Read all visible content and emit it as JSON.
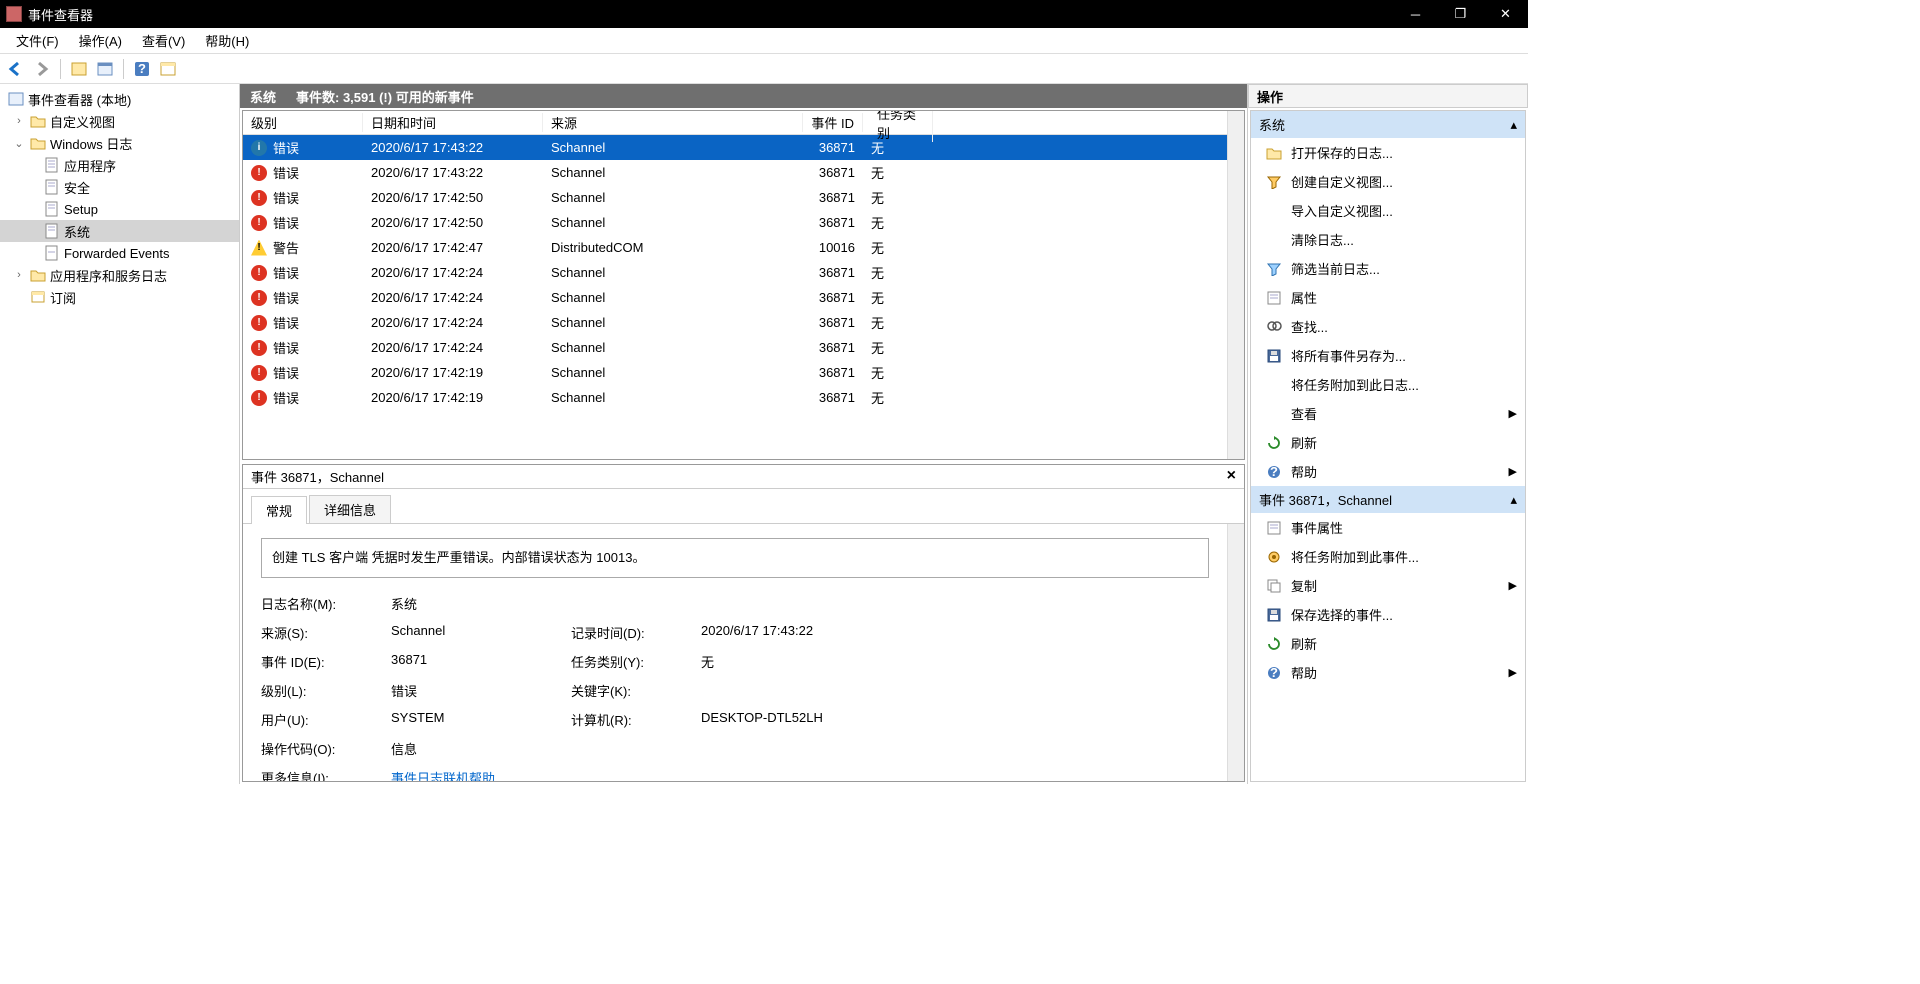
{
  "titlebar": {
    "title": "事件查看器"
  },
  "menubar": {
    "file": "文件(F)",
    "action": "操作(A)",
    "view": "查看(V)",
    "help": "帮助(H)"
  },
  "tree": {
    "root": "事件查看器 (本地)",
    "customViews": "自定义视图",
    "winLogs": "Windows 日志",
    "app": "应用程序",
    "security": "安全",
    "setup": "Setup",
    "system": "系统",
    "forwarded": "Forwarded Events",
    "appServices": "应用程序和服务日志",
    "subscriptions": "订阅"
  },
  "centerHeader": {
    "name": "系统",
    "count": "事件数: 3,591 (!) 可用的新事件"
  },
  "columns": {
    "level": "级别",
    "date": "日期和时间",
    "source": "来源",
    "id": "事件 ID",
    "task": "任务类别"
  },
  "events": [
    {
      "iconType": "info",
      "level": "错误",
      "date": "2020/6/17 17:43:22",
      "source": "Schannel",
      "id": "36871",
      "task": "无",
      "selected": true
    },
    {
      "iconType": "err",
      "level": "错误",
      "date": "2020/6/17 17:43:22",
      "source": "Schannel",
      "id": "36871",
      "task": "无"
    },
    {
      "iconType": "err",
      "level": "错误",
      "date": "2020/6/17 17:42:50",
      "source": "Schannel",
      "id": "36871",
      "task": "无"
    },
    {
      "iconType": "err",
      "level": "错误",
      "date": "2020/6/17 17:42:50",
      "source": "Schannel",
      "id": "36871",
      "task": "无"
    },
    {
      "iconType": "warn",
      "level": "警告",
      "date": "2020/6/17 17:42:47",
      "source": "DistributedCOM",
      "id": "10016",
      "task": "无"
    },
    {
      "iconType": "err",
      "level": "错误",
      "date": "2020/6/17 17:42:24",
      "source": "Schannel",
      "id": "36871",
      "task": "无"
    },
    {
      "iconType": "err",
      "level": "错误",
      "date": "2020/6/17 17:42:24",
      "source": "Schannel",
      "id": "36871",
      "task": "无"
    },
    {
      "iconType": "err",
      "level": "错误",
      "date": "2020/6/17 17:42:24",
      "source": "Schannel",
      "id": "36871",
      "task": "无"
    },
    {
      "iconType": "err",
      "level": "错误",
      "date": "2020/6/17 17:42:24",
      "source": "Schannel",
      "id": "36871",
      "task": "无"
    },
    {
      "iconType": "err",
      "level": "错误",
      "date": "2020/6/17 17:42:19",
      "source": "Schannel",
      "id": "36871",
      "task": "无"
    },
    {
      "iconType": "err",
      "level": "错误",
      "date": "2020/6/17 17:42:19",
      "source": "Schannel",
      "id": "36871",
      "task": "无"
    }
  ],
  "detail": {
    "title": "事件 36871，Schannel",
    "tabGeneral": "常规",
    "tabDetails": "详细信息",
    "description": "创建 TLS 客户端 凭据时发生严重错误。内部错误状态为 10013。",
    "labels": {
      "logName": "日志名称(M):",
      "source": "来源(S):",
      "eventId": "事件 ID(E):",
      "level": "级别(L):",
      "user": "用户(U):",
      "opcode": "操作代码(O):",
      "moreInfo": "更多信息(I):",
      "logged": "记录时间(D):",
      "category": "任务类别(Y):",
      "keywords": "关键字(K):",
      "computer": "计算机(R):"
    },
    "values": {
      "logName": "系统",
      "source": "Schannel",
      "eventId": "36871",
      "level": "错误",
      "user": "SYSTEM",
      "opcode": "信息",
      "moreInfoLink": "事件日志联机帮助",
      "logged": "2020/6/17 17:43:22",
      "category": "无",
      "keywords": "",
      "computer": "DESKTOP-DTL52LH"
    }
  },
  "actions": {
    "header": "操作",
    "section1": "系统",
    "items1": [
      {
        "icon": "open",
        "label": "打开保存的日志..."
      },
      {
        "icon": "filter",
        "label": "创建自定义视图..."
      },
      {
        "icon": "none",
        "label": "导入自定义视图..."
      },
      {
        "icon": "none",
        "label": "清除日志..."
      },
      {
        "icon": "filter2",
        "label": "筛选当前日志..."
      },
      {
        "icon": "props",
        "label": "属性"
      },
      {
        "icon": "find",
        "label": "查找..."
      },
      {
        "icon": "save",
        "label": "将所有事件另存为..."
      },
      {
        "icon": "none",
        "label": "将任务附加到此日志..."
      },
      {
        "icon": "none",
        "label": "查看",
        "sub": true
      },
      {
        "icon": "refresh",
        "label": "刷新"
      },
      {
        "icon": "help",
        "label": "帮助",
        "sub": true
      }
    ],
    "section2": "事件 36871，Schannel",
    "items2": [
      {
        "icon": "props",
        "label": "事件属性"
      },
      {
        "icon": "attach",
        "label": "将任务附加到此事件..."
      },
      {
        "icon": "copy",
        "label": "复制",
        "sub": true
      },
      {
        "icon": "save",
        "label": "保存选择的事件..."
      },
      {
        "icon": "refresh",
        "label": "刷新"
      },
      {
        "icon": "help",
        "label": "帮助",
        "sub": true
      }
    ]
  }
}
